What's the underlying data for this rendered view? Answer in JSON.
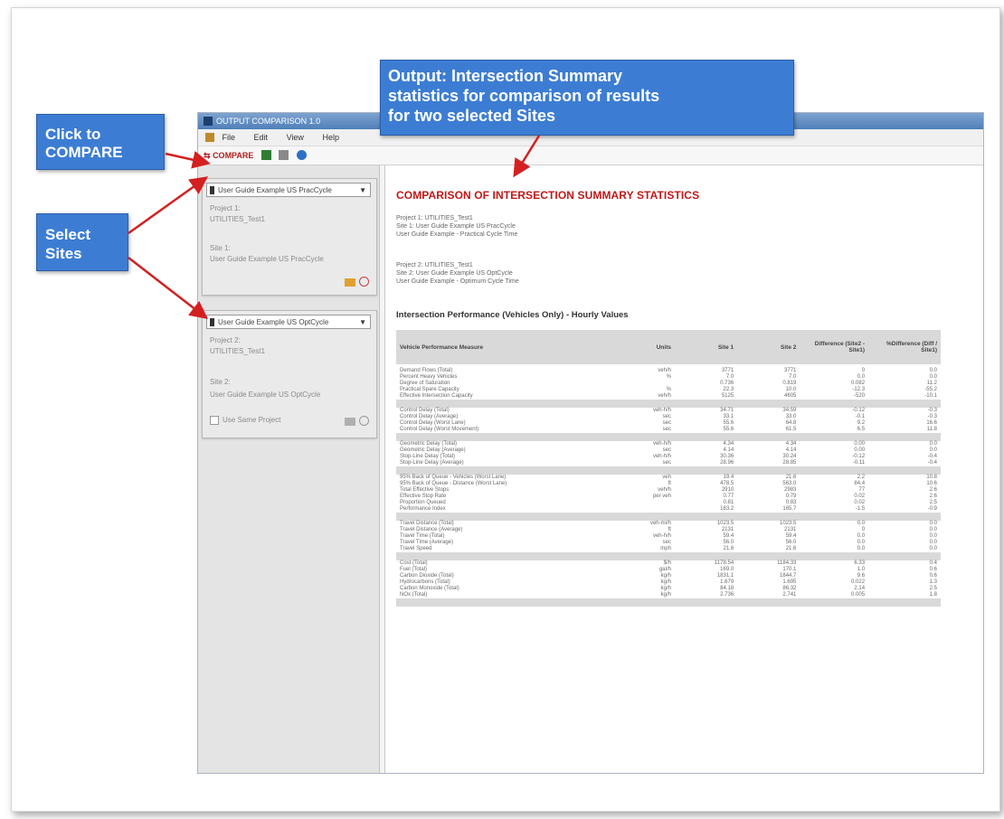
{
  "window": {
    "title": "OUTPUT COMPARISON 1.0",
    "menu": [
      "File",
      "Edit",
      "View",
      "Help"
    ]
  },
  "toolbar": {
    "compare_label": "COMPARE"
  },
  "sites": [
    {
      "selected": "User Guide Example US PracCycle",
      "project_label": "Project 1:",
      "project_value": "UTILITIES_Test1",
      "site_label": "Site 1:",
      "site_value": "User Guide Example US PracCycle"
    },
    {
      "selected": "User Guide Example US OptCycle",
      "project_label": "Project 2:",
      "project_value": "UTILITIES_Test1",
      "site_label": "Site 2:",
      "site_value": "User Guide Example US OptCycle",
      "use_same_project_label": "Use Same Project"
    }
  ],
  "report": {
    "title": "COMPARISON OF INTERSECTION SUMMARY STATISTICS",
    "project1_lines": [
      "Project 1: UTILITIES_Test1",
      "Site 1: User Guide Example US PracCycle",
      "User Guide Example - Practical Cycle Time"
    ],
    "project2_lines": [
      "Project 2: UTILITIES_Test1",
      "Site 2: User Guide Example US OptCycle",
      "User Guide Example - Optimum Cycle Time"
    ],
    "section_title": "Intersection Performance (Vehicles Only) - Hourly Values",
    "columns": [
      "Vehicle Performance Measure",
      "Units",
      "Site 1",
      "Site 2",
      "Difference (Site2 - Site1)",
      "%Difference (Diff / Site1)"
    ],
    "groups": [
      [
        [
          "Demand Flows (Total)",
          "veh/h",
          "3771",
          "3771",
          "0",
          "0.0"
        ],
        [
          "Percent Heavy Vehicles",
          "%",
          "7.0",
          "7.0",
          "0.0",
          "0.0"
        ],
        [
          "Degree of Saturation",
          "",
          "0.736",
          "0.819",
          "0.082",
          "11.2"
        ],
        [
          "Practical Spare Capacity",
          "%",
          "22.3",
          "10.0",
          "-12.3",
          "-55.2"
        ],
        [
          "Effective Intersection Capacity",
          "veh/h",
          "5125",
          "4605",
          "-520",
          "-10.1"
        ]
      ],
      [
        [
          "Control Delay (Total)",
          "veh-h/h",
          "34.71",
          "34.59",
          "-0.12",
          "-0.3"
        ],
        [
          "Control Delay (Average)",
          "sec",
          "33.1",
          "33.0",
          "-0.1",
          "-0.3"
        ],
        [
          "Control Delay (Worst Lane)",
          "sec",
          "55.6",
          "64.8",
          "9.2",
          "16.6"
        ],
        [
          "Control Delay (Worst Movement)",
          "sec",
          "55.6",
          "61.5",
          "6.5",
          "11.8"
        ]
      ],
      [
        [
          "Geometric Delay (Total)",
          "veh-h/h",
          "4.34",
          "4.34",
          "0.00",
          "0.0"
        ],
        [
          "Geometric Delay (Average)",
          "sec",
          "4.14",
          "4.14",
          "0.00",
          "0.0"
        ],
        [
          "Stop-Line Delay (Total)",
          "veh-h/h",
          "30.36",
          "30.24",
          "-0.12",
          "-0.4"
        ],
        [
          "Stop-Line Delay (Average)",
          "sec",
          "28.96",
          "28.85",
          "-0.11",
          "-0.4"
        ]
      ],
      [
        [
          "95% Back of Queue - Vehicles (Worst Lane)",
          "veh",
          "19.4",
          "21.6",
          "2.2",
          "10.8"
        ],
        [
          "95% Back of Queue - Distance (Worst Lane)",
          "ft",
          "478.5",
          "563.0",
          "84.4",
          "10.6"
        ],
        [
          "Total Effective Stops",
          "veh/h",
          "2910",
          "2983",
          "77",
          "2.6"
        ],
        [
          "Effective Stop Rate",
          "per veh",
          "0.77",
          "0.79",
          "0.02",
          "2.6"
        ],
        [
          "Proportion Queued",
          "",
          "0.81",
          "0.83",
          "0.02",
          "2.5"
        ],
        [
          "Performance Index",
          "",
          "163.2",
          "165.7",
          "-1.5",
          "-0.9"
        ]
      ],
      [
        [
          "Travel Distance (Total)",
          "veh-mi/h",
          "1023.5",
          "1023.5",
          "0.0",
          "0.0"
        ],
        [
          "Travel Distance (Average)",
          "ft",
          "2131",
          "2131",
          "0",
          "0.0"
        ],
        [
          "Travel Time (Total)",
          "veh-h/h",
          "59.4",
          "59.4",
          "0.0",
          "0.0"
        ],
        [
          "Travel Time (Average)",
          "sec",
          "56.0",
          "56.0",
          "0.0",
          "0.0"
        ],
        [
          "Travel Speed",
          "mph",
          "21.6",
          "21.6",
          "0.0",
          "0.0"
        ]
      ],
      [
        [
          "Cost (Total)",
          "$/h",
          "1178.54",
          "1184.33",
          "6.33",
          "0.4"
        ],
        [
          "Fuel (Total)",
          "gal/h",
          "169.0",
          "170.1",
          "1.0",
          "0.6"
        ],
        [
          "Carbon Dioxide (Total)",
          "kg/h",
          "1831.1",
          "1844.7",
          "9.6",
          "0.6"
        ],
        [
          "Hydrocarbons (Total)",
          "kg/h",
          "1.679",
          "1.695",
          "0.022",
          "1.3"
        ],
        [
          "Carbon Monoxide (Total)",
          "kg/h",
          "84.18",
          "86.32",
          "2.14",
          "2.5"
        ],
        [
          "NOx (Total)",
          "kg/h",
          "2.736",
          "2.741",
          "0.005",
          "1.8"
        ]
      ]
    ]
  },
  "callouts": {
    "compare": [
      "Click to",
      "COMPARE"
    ],
    "sites": [
      "Select",
      "Sites"
    ],
    "output": [
      "Output: Intersection Summary",
      "statistics for comparison of results",
      "for two selected Sites"
    ]
  },
  "colors": {
    "callout": "#3c7dd3",
    "title_red": "#c01818",
    "arrow": "#d42020"
  }
}
